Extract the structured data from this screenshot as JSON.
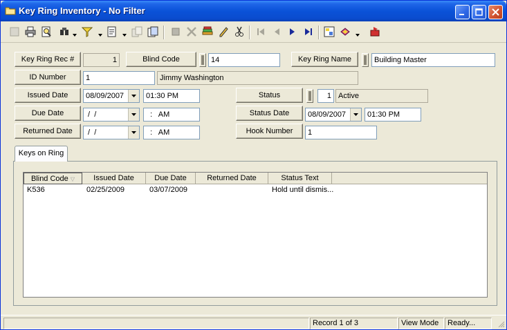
{
  "window": {
    "title": "Key Ring Inventory - No Filter"
  },
  "toolbar": {
    "icons": [
      "new-record-icon",
      "print-icon",
      "print-preview-icon",
      "find-icon",
      "filter-icon",
      "report-icon",
      "copy-icon",
      "layout-icon",
      "delete-icon",
      "cancel-icon",
      "save-icon",
      "edit-icon",
      "cut-icon",
      "first-record-icon",
      "previous-record-icon",
      "next-record-icon",
      "last-record-icon",
      "select-icon",
      "book-icon",
      "exit-icon"
    ]
  },
  "form": {
    "key_ring_rec": {
      "label": "Key Ring Rec #",
      "value": "1"
    },
    "blind_code": {
      "label": "Blind Code",
      "value": "14"
    },
    "key_ring_name": {
      "label": "Key Ring Name",
      "value": "Building Master"
    },
    "id_number": {
      "label": "ID Number",
      "value": "1",
      "name": "Jimmy Washington"
    },
    "issued_date": {
      "label": "Issued Date",
      "date": "08/09/2007",
      "time": "01:30 PM"
    },
    "due_date": {
      "label": "Due Date",
      "date": " /  /",
      "time": "  :   AM"
    },
    "returned_date": {
      "label": "Returned Date",
      "date": " /  /",
      "time": "  :   AM"
    },
    "status": {
      "label": "Status",
      "code": "1",
      "text": "Active"
    },
    "status_date": {
      "label": "Status Date",
      "date": "08/09/2007",
      "time": "01:30 PM"
    },
    "hook_number": {
      "label": "Hook Number",
      "value": "1"
    }
  },
  "tab": {
    "label": "Keys on Ring"
  },
  "grid": {
    "columns": [
      "Blind Code",
      "Issued Date",
      "Due Date",
      "Returned Date",
      "Status Text"
    ],
    "rows": [
      {
        "blind_code": "K536",
        "issued_date": "02/25/2009",
        "due_date": "03/07/2009",
        "returned_date": "",
        "status_text": "Hold until dismis..."
      }
    ]
  },
  "statusbar": {
    "record": "Record 1 of 3",
    "mode": "View Mode",
    "state": "Ready..."
  }
}
